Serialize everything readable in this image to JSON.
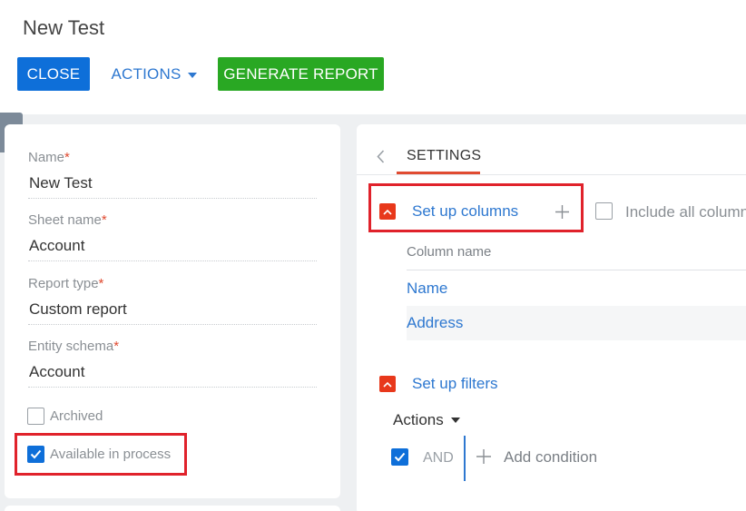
{
  "page": {
    "title": "New Test"
  },
  "toolbar": {
    "close_label": "CLOSE",
    "actions_label": "ACTIONS",
    "generate_label": "GENERATE REPORT"
  },
  "form": {
    "name": {
      "label": "Name",
      "value": "New Test"
    },
    "sheet_name": {
      "label": "Sheet name",
      "value": "Account"
    },
    "report_type": {
      "label": "Report type",
      "value": "Custom report"
    },
    "entity_schema": {
      "label": "Entity schema",
      "value": "Account"
    },
    "required_mark": "*",
    "archived": {
      "label": "Archived",
      "checked": false
    },
    "available_in_process": {
      "label": "Available in process",
      "checked": true
    }
  },
  "settings": {
    "tab_label": "SETTINGS",
    "columns": {
      "title": "Set up columns",
      "include_all_label": "Include all columns",
      "header": "Column name",
      "rows": [
        "Name",
        "Address"
      ]
    },
    "filters": {
      "title": "Set up filters",
      "actions_label": "Actions",
      "and_label": "AND",
      "and_checked": true,
      "add_condition_label": "Add condition"
    }
  },
  "colors": {
    "primary": "#0e6fd9",
    "success": "#29a823",
    "accent": "#e8381b",
    "link": "#2e78d0",
    "highlight": "#e0222b"
  }
}
